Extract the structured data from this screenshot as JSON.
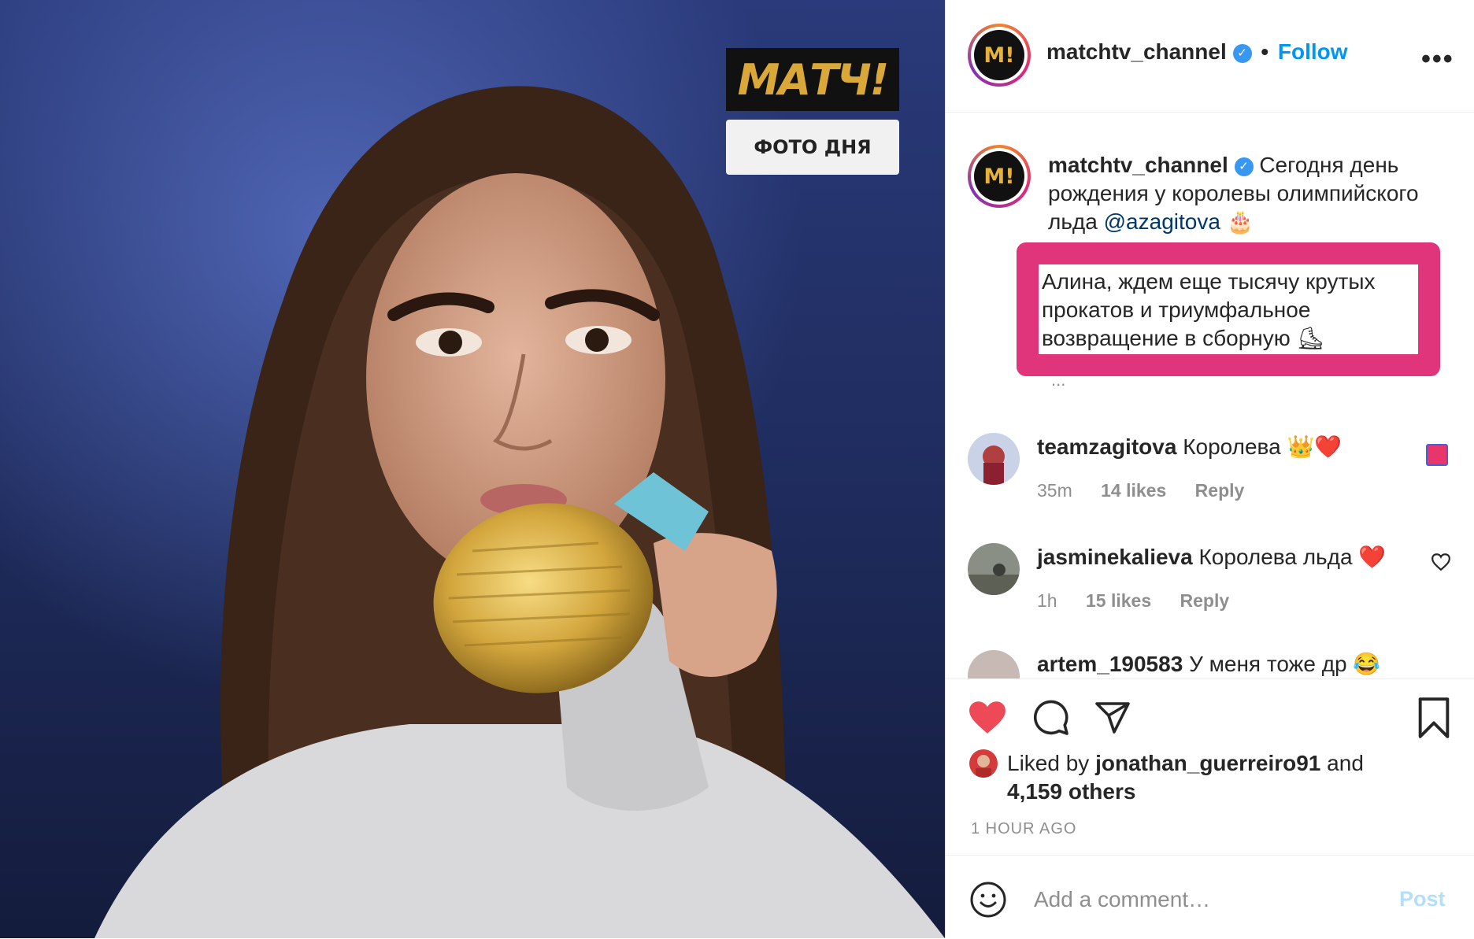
{
  "post": {
    "username": "matchtv_channel",
    "follow_label": "Follow",
    "overlay_logo_text": "МАТЧ!",
    "overlay_badge": "ФОТО ДНЯ"
  },
  "caption": {
    "username": "matchtv_channel",
    "text_part1": "Сегодня день рождения у королевы олимпийского льда",
    "mention": "@azagitova",
    "emoji1": "🎂",
    "highlight_text": "Алина, ждем еще тысячу крутых прокатов и триумфальное возвращение в сборную",
    "emoji2": "⛸",
    "more": "..."
  },
  "comments": [
    {
      "username": "teamzagitova",
      "text": "Королева",
      "emoji": "👑❤️",
      "time": "35m",
      "likes": "14 likes",
      "reply": "Reply"
    },
    {
      "username": "jasminekalieva",
      "text": "Королева льда",
      "emoji": "❤️",
      "time": "1h",
      "likes": "15 likes",
      "reply": "Reply"
    },
    {
      "username": "artem_190583",
      "text": "У меня тоже др",
      "emoji": "😂"
    }
  ],
  "likes": {
    "prefix": "Liked by",
    "user": "jonathan_guerreiro91",
    "and": "and",
    "count": "4,159 others"
  },
  "timestamp": "1 HOUR AGO",
  "add_comment": {
    "placeholder": "Add a comment…",
    "post_label": "Post"
  },
  "colors": {
    "accent": "#0095f6",
    "highlight_border": "#e0357a",
    "like_red": "#ed4956"
  },
  "icons": [
    "heart-icon",
    "comment-icon",
    "share-icon",
    "bookmark-icon",
    "more-icon",
    "emoji-icon",
    "verified-icon"
  ]
}
